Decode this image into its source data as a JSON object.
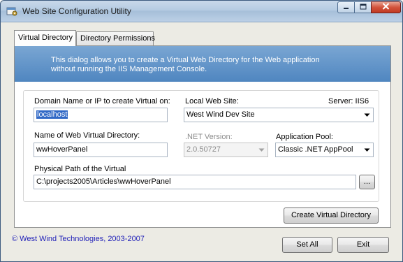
{
  "window": {
    "title": "Web Site Configuration Utility"
  },
  "tabs": [
    {
      "label": "Virtual Directory",
      "active": true
    },
    {
      "label": "Directory Permissions",
      "active": false
    }
  ],
  "banner": {
    "text": "This dialog allows you to create a Virtual Web Directory for the Web application\nwithout running the IIS Management Console."
  },
  "form": {
    "domain_label": "Domain Name or IP to create Virtual on:",
    "domain_value": "localhost",
    "local_site_label": "Local Web Site:",
    "server_label": "Server: IIS6",
    "local_site_value": "West Wind Dev Site",
    "vdir_label": "Name of Web Virtual Directory:",
    "vdir_value": "wwHoverPanel",
    "net_label": ".NET Version:",
    "net_value": "2.0.50727",
    "pool_label": "Application Pool:",
    "pool_value": "Classic .NET AppPool",
    "path_label": "Physical Path of the Virtual",
    "path_value": "C:\\projects2005\\Articles\\wwHoverPanel",
    "browse_label": "...",
    "create_button": "Create Virtual Directory"
  },
  "footer": {
    "copyright": "© West Wind Technologies, 2003-2007",
    "set_all_button": "Set All",
    "exit_button": "Exit"
  },
  "icons": {
    "app": "settings-window-icon",
    "minimize": "minimize-icon",
    "maximize": "maximize-icon",
    "close": "close-icon",
    "dropdown": "chevron-down-icon"
  },
  "colors": {
    "banner": "#5b8fc7",
    "selection": "#3169c6",
    "copyright": "#1f1fb8",
    "close_button": "#c8432b"
  }
}
